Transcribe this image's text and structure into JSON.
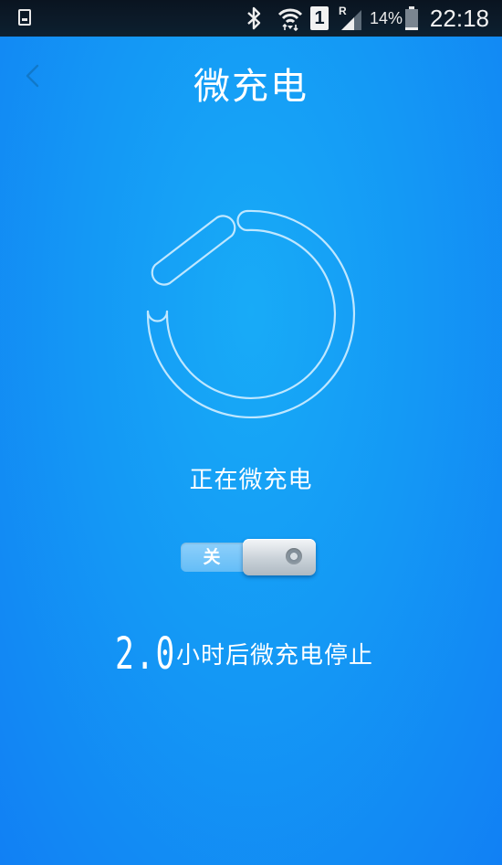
{
  "status_bar": {
    "battery_percent": "14%",
    "battery_level": 0.14,
    "time": "22:18",
    "sim_label": "1",
    "roaming_label": "R",
    "icons": [
      "sim-card-icon",
      "bluetooth-icon",
      "wifi-icon",
      "sim-1-icon",
      "signal-icon",
      "battery-icon"
    ]
  },
  "header": {
    "title": "微充电",
    "back_icon": "chevron-left-icon"
  },
  "charging": {
    "ring_icon": "power-ring-icon",
    "status": "正在微充电"
  },
  "toggle": {
    "label": "关",
    "state": "off"
  },
  "footer": {
    "hours_value": "2.0",
    "hours_text": "小时后微充电停止"
  },
  "colors": {
    "background": "#1499f5",
    "text": "#ffffff",
    "status_bar": "#0b1a2a"
  }
}
